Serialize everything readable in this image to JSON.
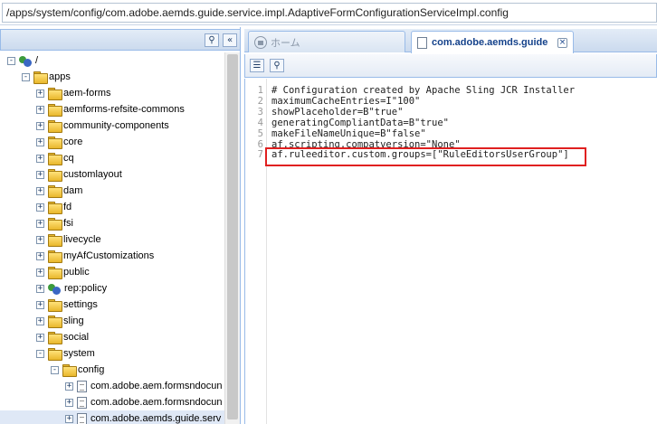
{
  "pathbar": {
    "value": "/apps/system/config/com.adobe.aemds.guide.service.impl.AdaptiveFormConfigurationServiceImpl.config"
  },
  "left_panel": {
    "buttons": [
      {
        "icon": "binoculars-icon"
      },
      {
        "icon": "collapse-left-icon"
      }
    ],
    "tree": [
      {
        "label": "/",
        "icon": "users-icon",
        "expander": "-",
        "level": 0
      },
      {
        "label": "apps",
        "icon": "folder-icon",
        "expander": "-",
        "level": 1
      },
      {
        "label": "aem-forms",
        "icon": "folder-icon",
        "expander": "+",
        "level": 2
      },
      {
        "label": "aemforms-refsite-commons",
        "icon": "folder-icon",
        "expander": "+",
        "level": 2
      },
      {
        "label": "community-components",
        "icon": "folder-icon",
        "expander": "+",
        "level": 2
      },
      {
        "label": "core",
        "icon": "folder-icon",
        "expander": "+",
        "level": 2
      },
      {
        "label": "cq",
        "icon": "folder-icon",
        "expander": "+",
        "level": 2
      },
      {
        "label": "customlayout",
        "icon": "folder-icon",
        "expander": "+",
        "level": 2
      },
      {
        "label": "dam",
        "icon": "folder-icon",
        "expander": "+",
        "level": 2
      },
      {
        "label": "fd",
        "icon": "folder-icon",
        "expander": "+",
        "level": 2
      },
      {
        "label": "fsi",
        "icon": "folder-icon",
        "expander": "+",
        "level": 2
      },
      {
        "label": "livecycle",
        "icon": "folder-icon",
        "expander": "+",
        "level": 2
      },
      {
        "label": "myAfCustomizations",
        "icon": "folder-icon",
        "expander": "+",
        "level": 2
      },
      {
        "label": "public",
        "icon": "folder-icon",
        "expander": "+",
        "level": 2
      },
      {
        "label": "rep:policy",
        "icon": "users-icon",
        "expander": "+",
        "level": 2
      },
      {
        "label": "settings",
        "icon": "folder-icon",
        "expander": "+",
        "level": 2
      },
      {
        "label": "sling",
        "icon": "folder-icon",
        "expander": "+",
        "level": 2
      },
      {
        "label": "social",
        "icon": "folder-icon",
        "expander": "+",
        "level": 2
      },
      {
        "label": "system",
        "icon": "folder-icon",
        "expander": "-",
        "level": 2
      },
      {
        "label": "config",
        "icon": "folder-icon",
        "expander": "-",
        "level": 3
      },
      {
        "label": "com.adobe.aem.formsndocun",
        "icon": "file-icon",
        "expander": "+",
        "level": 4
      },
      {
        "label": "com.adobe.aem.formsndocun",
        "icon": "file-icon",
        "expander": "+",
        "level": 4
      },
      {
        "label": "com.adobe.aemds.guide.serv",
        "icon": "file-icon",
        "expander": "+",
        "level": 4,
        "selected": true
      }
    ]
  },
  "tabs": [
    {
      "label": "ホーム",
      "icon": "home-icon"
    },
    {
      "label": "com.adobe.aemds.guide",
      "icon": "document-icon"
    }
  ],
  "toolbar": {
    "buttons": [
      {
        "icon": "properties-icon"
      },
      {
        "icon": "binoculars-icon"
      }
    ]
  },
  "editor": {
    "lines": [
      {
        "n": "1",
        "text": "# Configuration created by Apache Sling JCR Installer"
      },
      {
        "n": "2",
        "text": "maximumCacheEntries=I\"100\""
      },
      {
        "n": "3",
        "text": "showPlaceholder=B\"true\""
      },
      {
        "n": "4",
        "text": "generatingCompliantData=B\"true\""
      },
      {
        "n": "5",
        "text": "makeFileNameUnique=B\"false\""
      },
      {
        "n": "6",
        "text": "af.scripting.compatversion=\"None\""
      },
      {
        "n": "7",
        "text": "af.ruleeditor.custom.groups=[\"RuleEditorsUserGroup\"]"
      }
    ],
    "highlight_color": "#e02020"
  }
}
